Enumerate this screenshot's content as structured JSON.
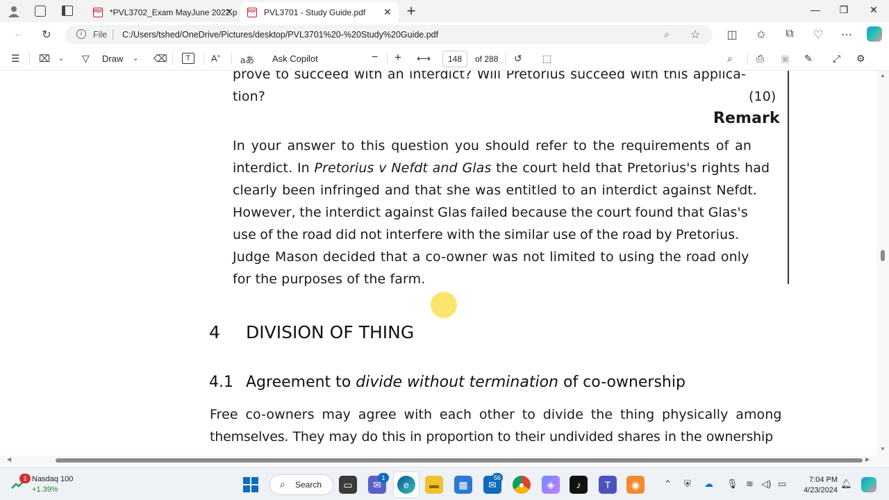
{
  "browser": {
    "tabs": [
      {
        "label": "*PVL3702_Exam MayJune 2022.p",
        "active": false
      },
      {
        "label": "PVL3701 - Study Guide.pdf",
        "active": true
      }
    ],
    "new_tab": "+",
    "address": {
      "scheme_label": "File",
      "url": "C:/Users/tshed/OneDrive/Pictures/desktop/PVL3701%20-%20Study%20Guide.pdf"
    }
  },
  "pdf_toolbar": {
    "draw_label": "Draw",
    "ask_copilot": "Ask Copilot",
    "page_number": "148",
    "page_total": "of 288",
    "zoom_out": "−",
    "zoom_in": "+"
  },
  "document": {
    "q_line1": "prove to succeed with an interdict? Will Pretorius succeed with this applica-",
    "q_line2": "tion?",
    "marks": "(10)",
    "remark_heading": "Remark",
    "remark_lines": [
      "In your answer to this question you should refer to the requirements of an",
      "interdict. In ",
      "Pretorius v Nefdt and Glas",
      " the court held that Pretorius's rights had",
      "clearly been infringed and that she was entitled to an interdict against Nefdt.",
      "However, the interdict against Glas failed because the court found that Glas's",
      "use of the road did not interfere with the similar use of the road by Pretorius.",
      "Judge Mason decided that a co-owner was not limited to using the road only",
      "for the purposes of the farm."
    ],
    "section_number": "4",
    "section_title": "DIVISION OF THING",
    "subsection_number": "4.1",
    "subsection_pre": "Agreement to ",
    "subsection_italic": "divide without termination",
    "subsection_post": " of co-ownership",
    "body_line1": "Free co-owners may agree with each other to divide the thing physically among",
    "body_line2": "themselves. They may do this in proportion to their undivided shares in the ownership"
  },
  "taskbar": {
    "stock_name": "Nasdaq 100",
    "stock_change": "+1.39%",
    "stock_badge": "1",
    "search_label": "Search",
    "teams_badge": "1",
    "mail_badge": "56",
    "time": "7:04 PM",
    "date": "4/23/2024"
  },
  "colors": {
    "accent": "#0f6cbd",
    "pdf_red": "#c4262e",
    "cursor_highlight": "#fadc3c"
  }
}
